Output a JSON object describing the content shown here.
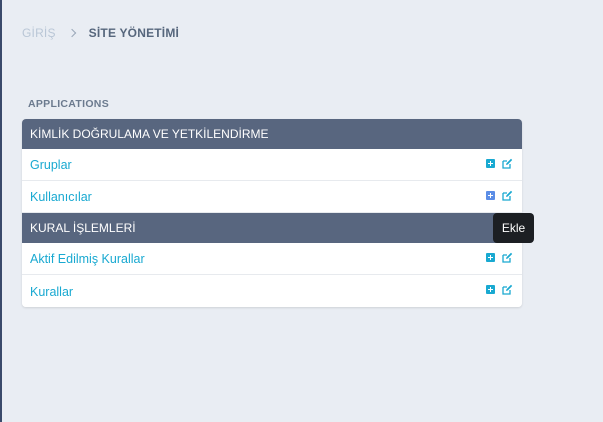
{
  "breadcrumb": {
    "home": "GİRİŞ",
    "current": "SİTE YÖNETİMİ"
  },
  "section_label": "APPLICATIONS",
  "groups": [
    {
      "title": "KİMLİK DOĞRULAMA VE YETKİLENDİRME",
      "items": [
        {
          "label": "Gruplar"
        },
        {
          "label": "Kullanıcılar"
        }
      ]
    },
    {
      "title": "KURAL İŞLEMLERİ",
      "items": [
        {
          "label": "Aktif Edilmiş Kurallar"
        },
        {
          "label": "Kurallar"
        }
      ]
    }
  ],
  "tooltip": "Ekle",
  "icons": {
    "add": "plus-square-icon",
    "edit": "edit-pencil-icon"
  },
  "colors": {
    "background": "#e9edf3",
    "header": "#58667f",
    "link": "#19a9d1",
    "tooltip": "#1c1f23"
  }
}
